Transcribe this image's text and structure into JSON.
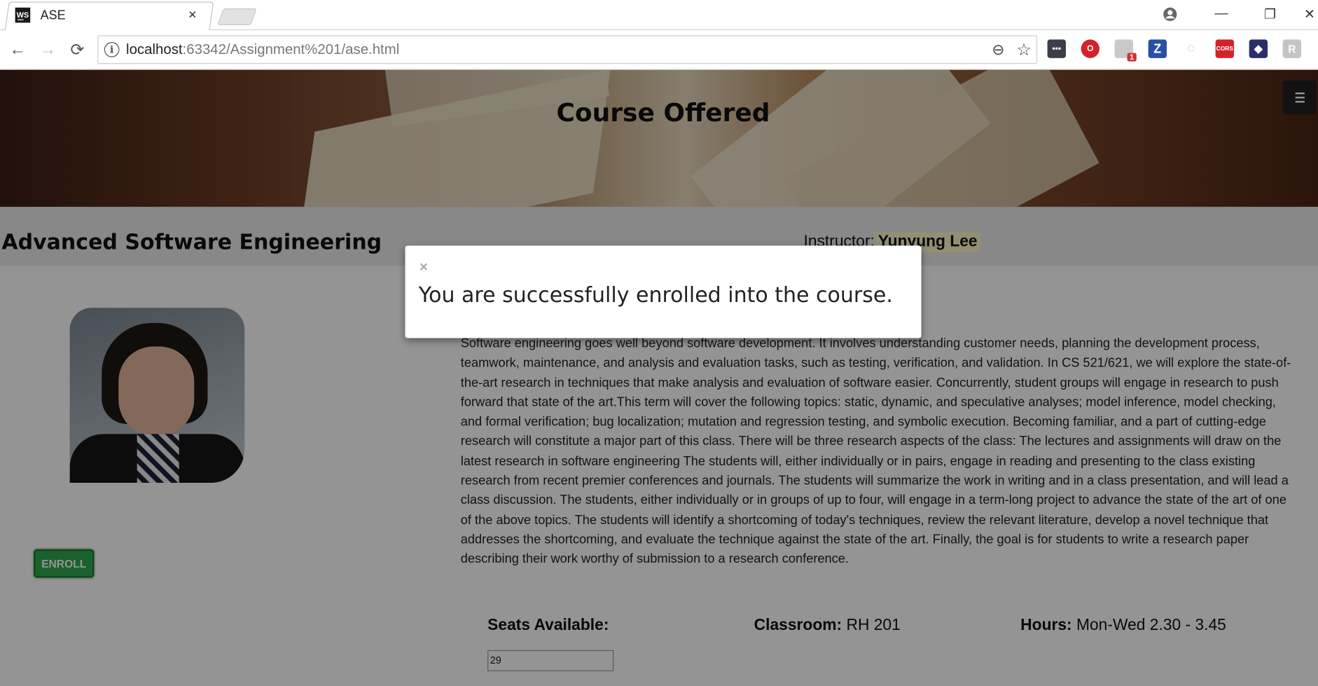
{
  "browser": {
    "tab_title": "ASE",
    "tab_icon_text": "WS",
    "tab_close": "×",
    "url_host": "localhost",
    "url_path": ":63342/Assignment%201/ase.html",
    "info_glyph": "i",
    "back_glyph": "←",
    "forward_glyph": "→",
    "reload_glyph": "⟳",
    "zoom_glyph": "⊖",
    "star_glyph": "☆",
    "window_controls": {
      "minimize": "—",
      "restore": "❐",
      "close": "✕"
    },
    "extensions": [
      {
        "name": "dots",
        "text": "•••",
        "color": "#3a3f4a"
      },
      {
        "name": "opera",
        "text": "O",
        "color": "#d3222a"
      },
      {
        "name": "shield",
        "text": "1",
        "color": "#c9c9c9"
      },
      {
        "name": "z",
        "text": "Z",
        "color": "#2a4fa0"
      },
      {
        "name": "swirl",
        "text": "◌",
        "color": "#d9d9d9"
      },
      {
        "name": "cors",
        "text": "CORS",
        "color": "#d3222a"
      },
      {
        "name": "cube",
        "text": "◆",
        "color": "#2a2f6a"
      },
      {
        "name": "r",
        "text": "R",
        "color": "#bdbdbd"
      }
    ]
  },
  "page": {
    "banner_title": "Course Offered",
    "menu_label": "menu",
    "course_title": "Advanced Software Engineering",
    "instructor_label": "Instructor: ",
    "instructor_name": "Yunyung Lee",
    "enroll_label": "ENROLL",
    "description": "Software engineering goes well beyond software development. It involves understanding customer needs, planning the development process, teamwork, maintenance, and analysis and evaluation tasks, such as testing, verification, and validation. In CS 521/621, we will explore the state-of-the-art research in techniques that make analysis and evaluation of software easier. Concurrently, student groups will engage in research to push forward that state of the art.This term will cover the following topics: static, dynamic, and speculative analyses; model inference, model checking, and formal verification; bug localization; mutation and regression testing, and symbolic execution. Becoming familiar, and a part of cutting-edge research will constitute a major part of this class. There will be three research aspects of the class: The lectures and assignments will draw on the latest research in software engineering The students will, either individually or in pairs, engage in reading and presenting to the class existing research from recent premier conferences and journals. The students will summarize the work in writing and in a class presentation, and will lead a class discussion. The students, either individually or in groups of up to four, will engage in a term-long project to advance the state of the art of one of the above topics. The students will identify a shortcoming of today's techniques, review the relevant literature, develop a novel technique that addresses the shortcoming, and evaluate the technique against the state of the art. Finally, the goal is for students to write a research paper describing their work worthy of submission to a research conference.",
    "seats_label": "Seats Available:",
    "seats_value": "29",
    "classroom_label": "Classroom:",
    "classroom_value": " RH 201",
    "hours_label": "Hours:",
    "hours_value": " Mon-Wed 2.30 - 3.45"
  },
  "modal": {
    "close_glyph": "×",
    "message": "You are successfully enrolled into the course."
  }
}
